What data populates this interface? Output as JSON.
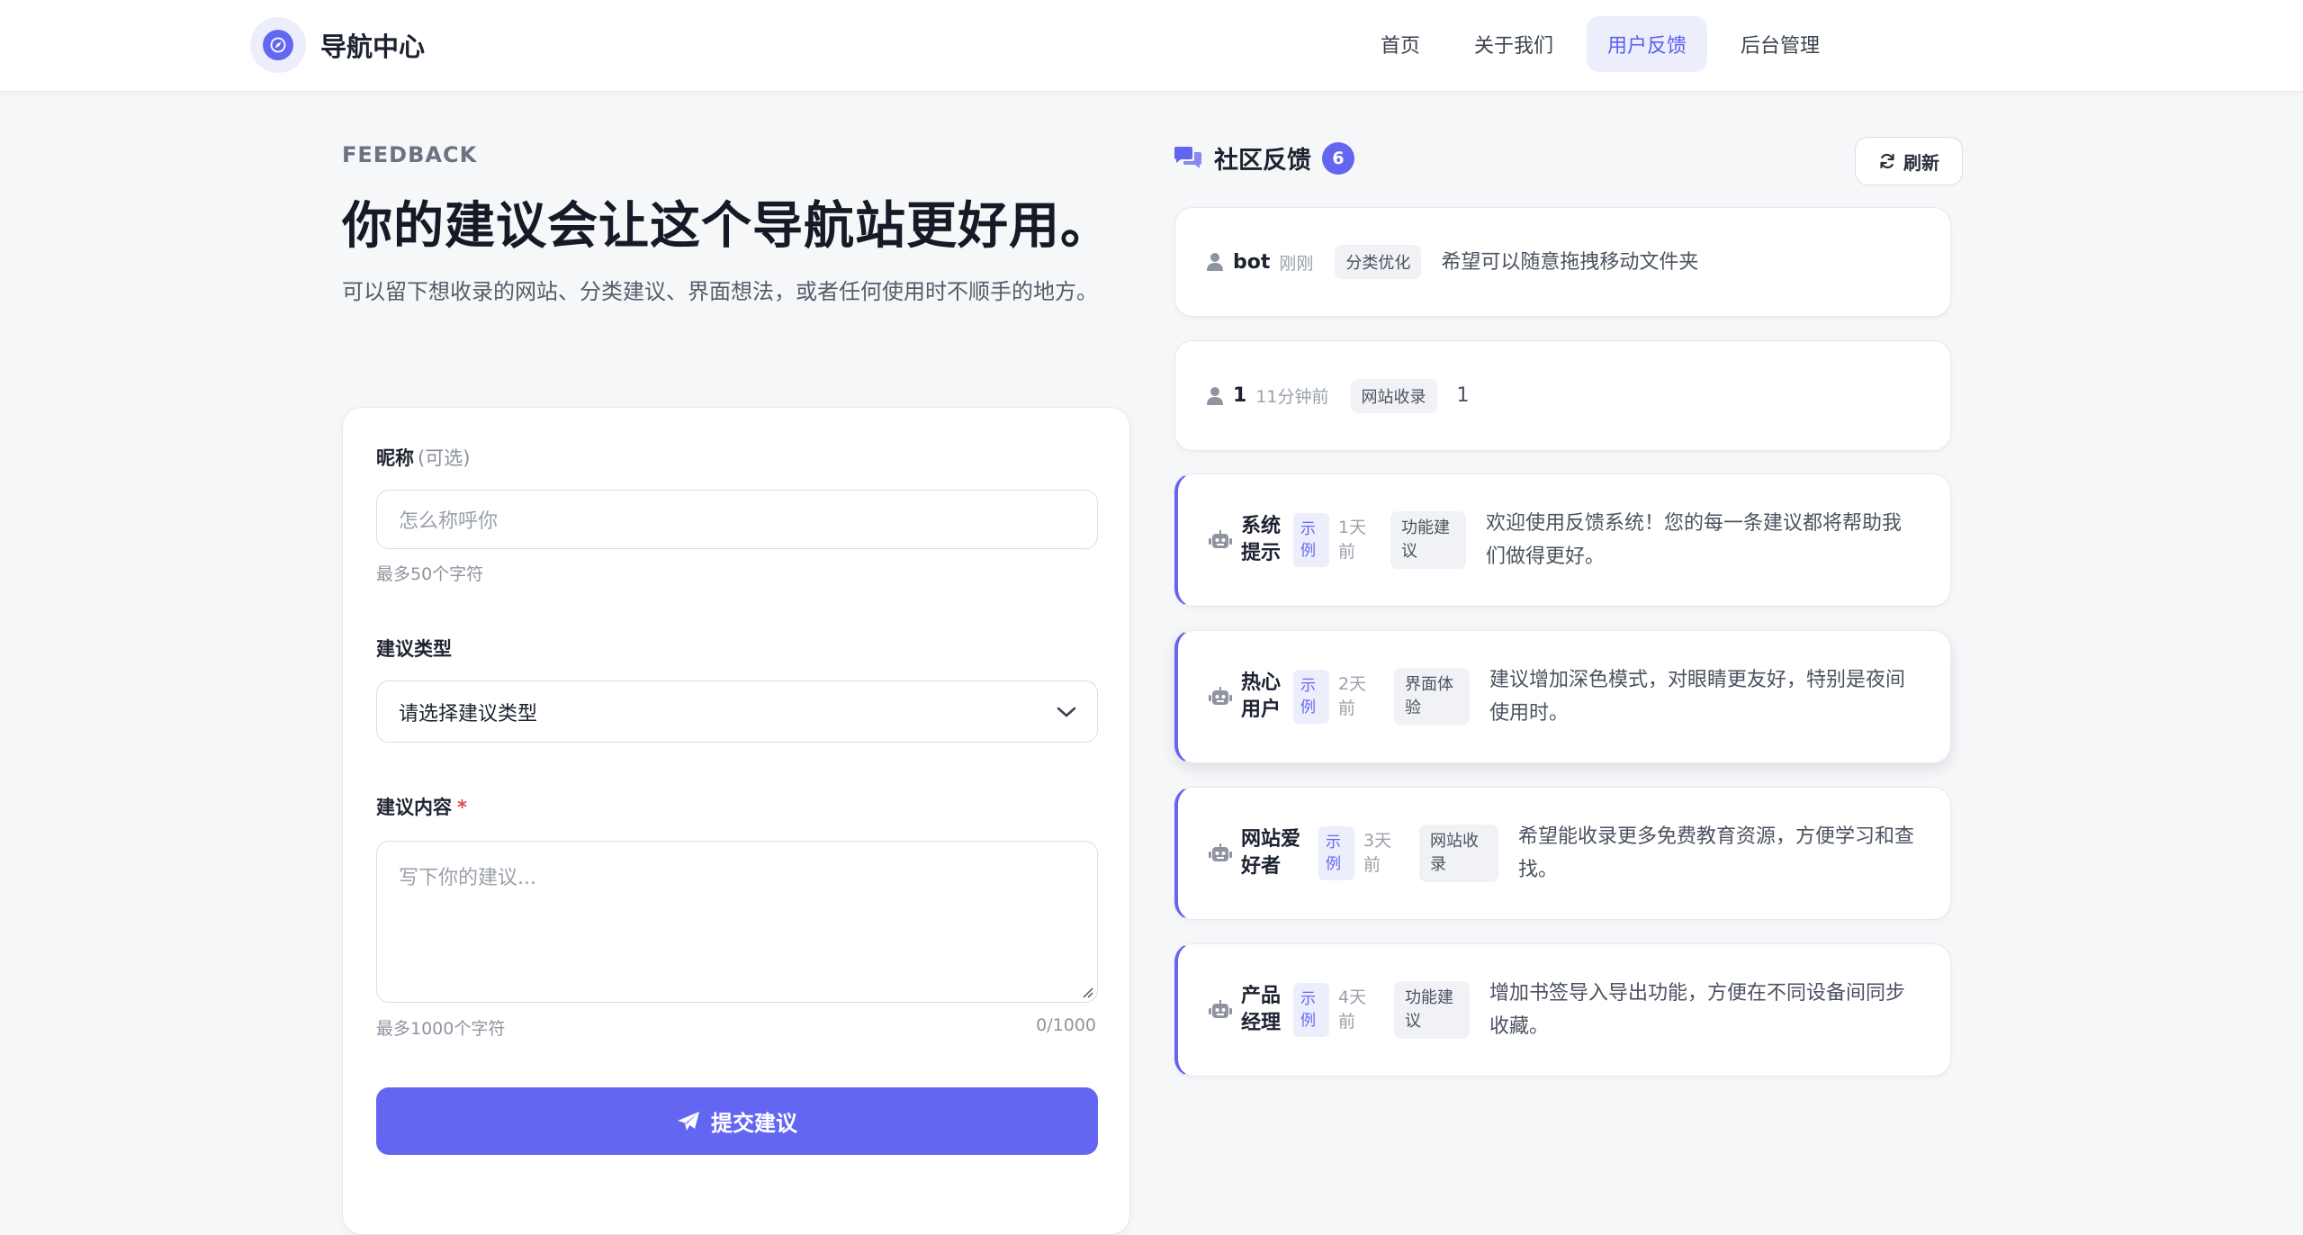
{
  "header": {
    "brand": "导航中心",
    "nav": [
      {
        "label": "首页",
        "active": false
      },
      {
        "label": "关于我们",
        "active": false
      },
      {
        "label": "用户反馈",
        "active": true
      },
      {
        "label": "后台管理",
        "active": false
      }
    ]
  },
  "hero": {
    "eyebrow": "FEEDBACK",
    "title": "你的建议会让这个导航站更好用。",
    "subtitle": "可以留下想收录的网站、分类建议、界面想法，或者任何使用时不顺手的地方。"
  },
  "form": {
    "nickname": {
      "label": "昵称",
      "optional": "(可选)",
      "placeholder": "怎么称呼你",
      "hint": "最多50个字符"
    },
    "type": {
      "label": "建议类型",
      "selected": "请选择建议类型"
    },
    "content": {
      "label": "建议内容",
      "required_mark": "*",
      "placeholder": "写下你的建议...",
      "hint": "最多1000个字符",
      "counter": "0/1000"
    },
    "submit_label": "提交建议"
  },
  "community": {
    "title": "社区反馈",
    "count": "6",
    "refresh_label": "刷新",
    "items": [
      {
        "name": "bot",
        "time": "刚刚",
        "category": "分类优化",
        "text": "希望可以随意拖拽移动文件夹",
        "sample": false,
        "icon": "user-icon"
      },
      {
        "name": "1",
        "time": "11分钟前",
        "category": "网站收录",
        "text": "1",
        "sample": false,
        "icon": "user-icon"
      },
      {
        "name": "系统提示",
        "sample_tag": "示例",
        "time": "1天前",
        "category": "功能建议",
        "text": "欢迎使用反馈系统！您的每一条建议都将帮助我们做得更好。",
        "sample": true,
        "icon": "robot-icon"
      },
      {
        "name": "热心用户",
        "sample_tag": "示例",
        "time": "2天前",
        "category": "界面体验",
        "text": "建议增加深色模式，对眼睛更友好，特别是夜间使用时。",
        "sample": true,
        "icon": "robot-icon"
      },
      {
        "name": "网站爱好者",
        "sample_tag": "示例",
        "time": "3天前",
        "category": "网站收录",
        "text": "希望能收录更多免费教育资源，方便学习和查找。",
        "sample": true,
        "icon": "robot-icon"
      },
      {
        "name": "产品经理",
        "sample_tag": "示例",
        "time": "4天前",
        "category": "功能建议",
        "text": "增加书签导入导出功能，方便在不同设备间同步收藏。",
        "sample": true,
        "icon": "robot-icon"
      }
    ]
  },
  "colors": {
    "accent": "#6366f1",
    "accent_soft": "#eceefc",
    "required": "#e5484d"
  }
}
